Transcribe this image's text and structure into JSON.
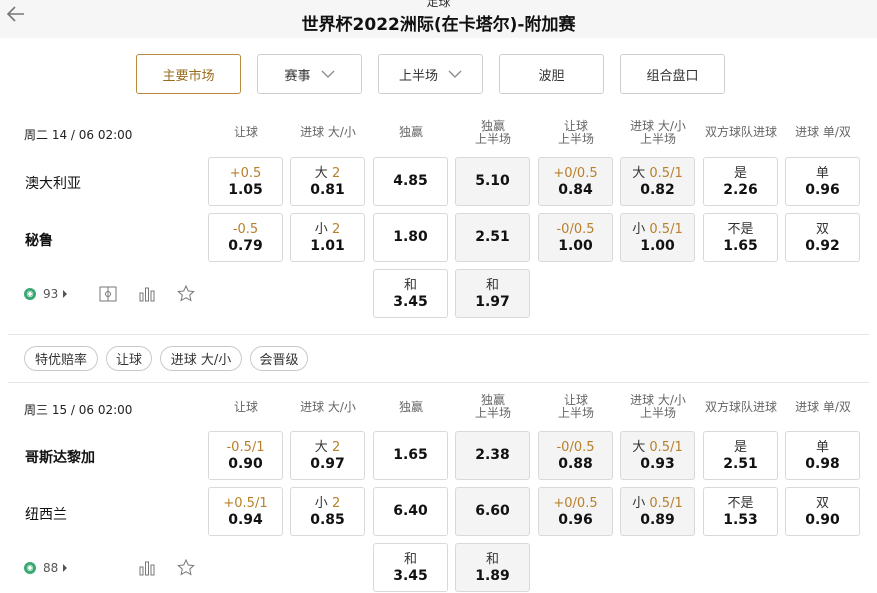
{
  "header": {
    "sup": "足球",
    "title": "世界杯2022洲际(在卡塔尔)-附加赛"
  },
  "filters": [
    {
      "label": "主要市场",
      "active": true
    },
    {
      "label": "赛事",
      "dropdown": true
    },
    {
      "label": "上半场",
      "dropdown": true
    },
    {
      "label": "波胆"
    },
    {
      "label": "组合盘口"
    }
  ],
  "columns": [
    {
      "line1": "让球",
      "line2": ""
    },
    {
      "line1": "进球 大/小",
      "line2": ""
    },
    {
      "line1": "独赢",
      "line2": ""
    },
    {
      "line1": "独赢",
      "line2": "上半场"
    },
    {
      "line1": "让球",
      "line2": "上半场"
    },
    {
      "line1": "进球 大/小",
      "line2": "上半场"
    },
    {
      "line1": "双方球队进球",
      "line2": ""
    },
    {
      "line1": "进球 单/双",
      "line2": ""
    }
  ],
  "matches": [
    {
      "datetime": "周二 14 / 06 02:00",
      "more_count": "93",
      "teams": [
        {
          "name": "澳大利亚",
          "bold": false,
          "odds": [
            {
              "label": "+0.5",
              "value": "1.05"
            },
            {
              "label": "大",
              "hl": "2",
              "value": "0.81"
            },
            {
              "label": "",
              "value": "4.85"
            },
            {
              "label": "",
              "value": "5.10"
            },
            {
              "label": "+0/0.5",
              "value": "0.84"
            },
            {
              "label": "大",
              "hl": "0.5/1",
              "value": "0.82"
            },
            {
              "label": "是",
              "value": "2.26"
            },
            {
              "label": "单",
              "value": "0.96"
            }
          ]
        },
        {
          "name": "秘鲁",
          "bold": true,
          "odds": [
            {
              "label": "-0.5",
              "value": "0.79"
            },
            {
              "label": "小",
              "hl": "2",
              "value": "1.01"
            },
            {
              "label": "",
              "value": "1.80"
            },
            {
              "label": "",
              "value": "2.51"
            },
            {
              "label": "-0/0.5",
              "value": "1.00"
            },
            {
              "label": "小",
              "hl": "0.5/1",
              "value": "1.00"
            },
            {
              "label": "不是",
              "value": "1.65"
            },
            {
              "label": "双",
              "value": "0.92"
            }
          ]
        }
      ],
      "draw": [
        {
          "label": "和",
          "value": "3.45"
        },
        {
          "label": "和",
          "value": "1.97"
        }
      ]
    },
    {
      "datetime": "周三 15 / 06 02:00",
      "more_count": "88",
      "teams": [
        {
          "name": "哥斯达黎加",
          "bold": true,
          "odds": [
            {
              "label": "-0.5/1",
              "value": "0.90"
            },
            {
              "label": "大",
              "hl": "2",
              "value": "0.97"
            },
            {
              "label": "",
              "value": "1.65"
            },
            {
              "label": "",
              "value": "2.38"
            },
            {
              "label": "-0/0.5",
              "value": "0.88"
            },
            {
              "label": "大",
              "hl": "0.5/1",
              "value": "0.93"
            },
            {
              "label": "是",
              "value": "2.51"
            },
            {
              "label": "单",
              "value": "0.98"
            }
          ]
        },
        {
          "name": "纽西兰",
          "bold": false,
          "odds": [
            {
              "label": "+0.5/1",
              "value": "0.94"
            },
            {
              "label": "小",
              "hl": "2",
              "value": "0.85"
            },
            {
              "label": "",
              "value": "6.40"
            },
            {
              "label": "",
              "value": "6.60"
            },
            {
              "label": "+0/0.5",
              "value": "0.96"
            },
            {
              "label": "小",
              "hl": "0.5/1",
              "value": "0.89"
            },
            {
              "label": "不是",
              "value": "1.53"
            },
            {
              "label": "双",
              "value": "0.90"
            }
          ]
        }
      ],
      "draw": [
        {
          "label": "和",
          "value": "3.45"
        },
        {
          "label": "和",
          "value": "1.89"
        }
      ]
    }
  ],
  "chips": [
    "特优赔率",
    "让球",
    "进球 大/小",
    "会晋级"
  ],
  "colors": {
    "accent": "#b8802a",
    "stats_icon": "#3aa872"
  }
}
